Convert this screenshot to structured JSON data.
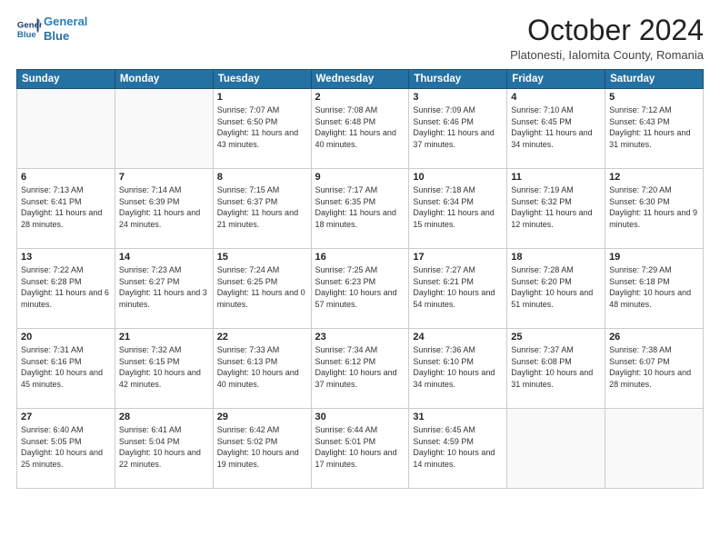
{
  "header": {
    "logo_line1": "General",
    "logo_line2": "Blue",
    "month_title": "October 2024",
    "location": "Platonesti, Ialomita County, Romania"
  },
  "days_of_week": [
    "Sunday",
    "Monday",
    "Tuesday",
    "Wednesday",
    "Thursday",
    "Friday",
    "Saturday"
  ],
  "weeks": [
    [
      {
        "day": "",
        "info": ""
      },
      {
        "day": "",
        "info": ""
      },
      {
        "day": "1",
        "info": "Sunrise: 7:07 AM\nSunset: 6:50 PM\nDaylight: 11 hours and 43 minutes."
      },
      {
        "day": "2",
        "info": "Sunrise: 7:08 AM\nSunset: 6:48 PM\nDaylight: 11 hours and 40 minutes."
      },
      {
        "day": "3",
        "info": "Sunrise: 7:09 AM\nSunset: 6:46 PM\nDaylight: 11 hours and 37 minutes."
      },
      {
        "day": "4",
        "info": "Sunrise: 7:10 AM\nSunset: 6:45 PM\nDaylight: 11 hours and 34 minutes."
      },
      {
        "day": "5",
        "info": "Sunrise: 7:12 AM\nSunset: 6:43 PM\nDaylight: 11 hours and 31 minutes."
      }
    ],
    [
      {
        "day": "6",
        "info": "Sunrise: 7:13 AM\nSunset: 6:41 PM\nDaylight: 11 hours and 28 minutes."
      },
      {
        "day": "7",
        "info": "Sunrise: 7:14 AM\nSunset: 6:39 PM\nDaylight: 11 hours and 24 minutes."
      },
      {
        "day": "8",
        "info": "Sunrise: 7:15 AM\nSunset: 6:37 PM\nDaylight: 11 hours and 21 minutes."
      },
      {
        "day": "9",
        "info": "Sunrise: 7:17 AM\nSunset: 6:35 PM\nDaylight: 11 hours and 18 minutes."
      },
      {
        "day": "10",
        "info": "Sunrise: 7:18 AM\nSunset: 6:34 PM\nDaylight: 11 hours and 15 minutes."
      },
      {
        "day": "11",
        "info": "Sunrise: 7:19 AM\nSunset: 6:32 PM\nDaylight: 11 hours and 12 minutes."
      },
      {
        "day": "12",
        "info": "Sunrise: 7:20 AM\nSunset: 6:30 PM\nDaylight: 11 hours and 9 minutes."
      }
    ],
    [
      {
        "day": "13",
        "info": "Sunrise: 7:22 AM\nSunset: 6:28 PM\nDaylight: 11 hours and 6 minutes."
      },
      {
        "day": "14",
        "info": "Sunrise: 7:23 AM\nSunset: 6:27 PM\nDaylight: 11 hours and 3 minutes."
      },
      {
        "day": "15",
        "info": "Sunrise: 7:24 AM\nSunset: 6:25 PM\nDaylight: 11 hours and 0 minutes."
      },
      {
        "day": "16",
        "info": "Sunrise: 7:25 AM\nSunset: 6:23 PM\nDaylight: 10 hours and 57 minutes."
      },
      {
        "day": "17",
        "info": "Sunrise: 7:27 AM\nSunset: 6:21 PM\nDaylight: 10 hours and 54 minutes."
      },
      {
        "day": "18",
        "info": "Sunrise: 7:28 AM\nSunset: 6:20 PM\nDaylight: 10 hours and 51 minutes."
      },
      {
        "day": "19",
        "info": "Sunrise: 7:29 AM\nSunset: 6:18 PM\nDaylight: 10 hours and 48 minutes."
      }
    ],
    [
      {
        "day": "20",
        "info": "Sunrise: 7:31 AM\nSunset: 6:16 PM\nDaylight: 10 hours and 45 minutes."
      },
      {
        "day": "21",
        "info": "Sunrise: 7:32 AM\nSunset: 6:15 PM\nDaylight: 10 hours and 42 minutes."
      },
      {
        "day": "22",
        "info": "Sunrise: 7:33 AM\nSunset: 6:13 PM\nDaylight: 10 hours and 40 minutes."
      },
      {
        "day": "23",
        "info": "Sunrise: 7:34 AM\nSunset: 6:12 PM\nDaylight: 10 hours and 37 minutes."
      },
      {
        "day": "24",
        "info": "Sunrise: 7:36 AM\nSunset: 6:10 PM\nDaylight: 10 hours and 34 minutes."
      },
      {
        "day": "25",
        "info": "Sunrise: 7:37 AM\nSunset: 6:08 PM\nDaylight: 10 hours and 31 minutes."
      },
      {
        "day": "26",
        "info": "Sunrise: 7:38 AM\nSunset: 6:07 PM\nDaylight: 10 hours and 28 minutes."
      }
    ],
    [
      {
        "day": "27",
        "info": "Sunrise: 6:40 AM\nSunset: 5:05 PM\nDaylight: 10 hours and 25 minutes."
      },
      {
        "day": "28",
        "info": "Sunrise: 6:41 AM\nSunset: 5:04 PM\nDaylight: 10 hours and 22 minutes."
      },
      {
        "day": "29",
        "info": "Sunrise: 6:42 AM\nSunset: 5:02 PM\nDaylight: 10 hours and 19 minutes."
      },
      {
        "day": "30",
        "info": "Sunrise: 6:44 AM\nSunset: 5:01 PM\nDaylight: 10 hours and 17 minutes."
      },
      {
        "day": "31",
        "info": "Sunrise: 6:45 AM\nSunset: 4:59 PM\nDaylight: 10 hours and 14 minutes."
      },
      {
        "day": "",
        "info": ""
      },
      {
        "day": "",
        "info": ""
      }
    ]
  ]
}
